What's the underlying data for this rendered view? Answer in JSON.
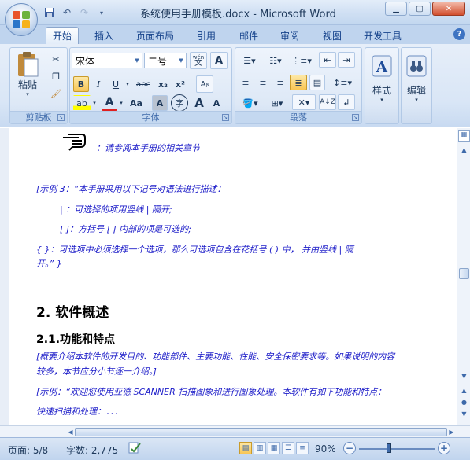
{
  "window": {
    "title": "系统使用手册模板.docx - Microsoft Word",
    "controls": [
      "minimize",
      "maximize",
      "close"
    ]
  },
  "quick_access": [
    "save-icon",
    "undo-icon",
    "redo-icon",
    "customize-icon"
  ],
  "tabs": [
    {
      "label": "开始",
      "active": true
    },
    {
      "label": "插入"
    },
    {
      "label": "页面布局"
    },
    {
      "label": "引用"
    },
    {
      "label": "邮件"
    },
    {
      "label": "审阅"
    },
    {
      "label": "视图"
    },
    {
      "label": "开发工具"
    }
  ],
  "ribbon": {
    "clipboard": {
      "paste_label": "粘贴",
      "group_label": "剪贴板"
    },
    "font": {
      "font_name": "宋体",
      "font_size": "二号",
      "wen_label": "wén\n文",
      "bold": "B",
      "italic": "I",
      "underline": "U",
      "strike": "abc",
      "subscript": "x₂",
      "superscript": "x²",
      "highlight": "ab",
      "font_color": "A",
      "change_case": "Aa",
      "char_shade": "A",
      "enclose": "字",
      "grow": "A",
      "shrink": "A",
      "group_label": "字体"
    },
    "paragraph": {
      "group_label": "段落"
    },
    "styles": {
      "label": "样式"
    },
    "editing": {
      "label": "编辑"
    }
  },
  "document": {
    "lines": [
      {
        "id": "ref",
        "text": "：请参阅本手册的相关章节"
      },
      {
        "id": "ex3",
        "text": "[示例 3：“本手册采用以下记号对语法进行描述："
      },
      {
        "id": "pipe",
        "text": "|    ：可选择的项用竖线 | 隔开;"
      },
      {
        "id": "bracket",
        "text": "[  ]：方括号 [  ] 内部的项是可选的;"
      },
      {
        "id": "brace1",
        "text": "{   }：可选项中必须选择一个选项，那么可选项包含在花括号 (   ) 中，    并由竖线 | 隔"
      },
      {
        "id": "brace2",
        "text": "开。”  }"
      },
      {
        "id": "h1",
        "text": "2.  软件概述"
      },
      {
        "id": "h2",
        "text": "2.1.功能和特点"
      },
      {
        "id": "p1",
        "text": "[概要介绍本软件的开发目的、功能部件、主要功能、性能、安全保密要求等。如果说明的内容"
      },
      {
        "id": "p2",
        "text": "较多，本节应分小节逐一介绍。]"
      },
      {
        "id": "p3",
        "text": "[示例：“欢迎您使用亚德 SCANNER 扫描图象和进行图象处理。本软件有如下功能和特点："
      },
      {
        "id": "p4",
        "text": "快速扫描和处理：．．．"
      }
    ]
  },
  "statusbar": {
    "page": "页面: 5/8",
    "words": "字数: 2,775",
    "zoom": "90%",
    "zoom_out": "−",
    "zoom_in": "+"
  },
  "colors": {
    "doc_blue": "#1b1bc8",
    "ribbon_bg": "#dde8f6",
    "active_btn": "#f8c555"
  }
}
